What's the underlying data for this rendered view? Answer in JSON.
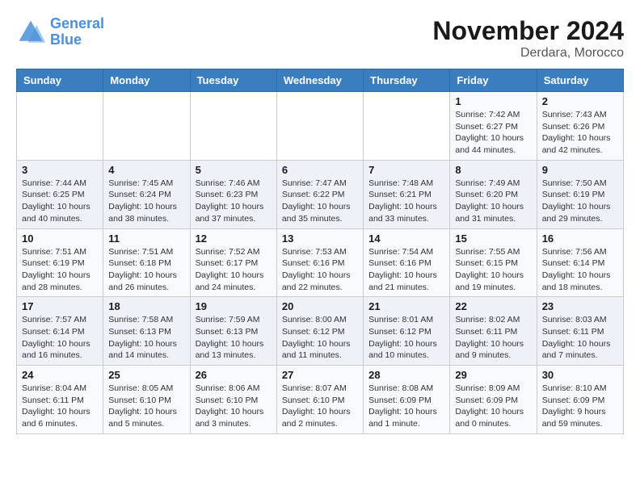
{
  "header": {
    "logo_line1": "General",
    "logo_line2": "Blue",
    "month": "November 2024",
    "location": "Derdara, Morocco"
  },
  "weekdays": [
    "Sunday",
    "Monday",
    "Tuesday",
    "Wednesday",
    "Thursday",
    "Friday",
    "Saturday"
  ],
  "weeks": [
    [
      {
        "day": "",
        "info": ""
      },
      {
        "day": "",
        "info": ""
      },
      {
        "day": "",
        "info": ""
      },
      {
        "day": "",
        "info": ""
      },
      {
        "day": "",
        "info": ""
      },
      {
        "day": "1",
        "info": "Sunrise: 7:42 AM\nSunset: 6:27 PM\nDaylight: 10 hours and 44 minutes."
      },
      {
        "day": "2",
        "info": "Sunrise: 7:43 AM\nSunset: 6:26 PM\nDaylight: 10 hours and 42 minutes."
      }
    ],
    [
      {
        "day": "3",
        "info": "Sunrise: 7:44 AM\nSunset: 6:25 PM\nDaylight: 10 hours and 40 minutes."
      },
      {
        "day": "4",
        "info": "Sunrise: 7:45 AM\nSunset: 6:24 PM\nDaylight: 10 hours and 38 minutes."
      },
      {
        "day": "5",
        "info": "Sunrise: 7:46 AM\nSunset: 6:23 PM\nDaylight: 10 hours and 37 minutes."
      },
      {
        "day": "6",
        "info": "Sunrise: 7:47 AM\nSunset: 6:22 PM\nDaylight: 10 hours and 35 minutes."
      },
      {
        "day": "7",
        "info": "Sunrise: 7:48 AM\nSunset: 6:21 PM\nDaylight: 10 hours and 33 minutes."
      },
      {
        "day": "8",
        "info": "Sunrise: 7:49 AM\nSunset: 6:20 PM\nDaylight: 10 hours and 31 minutes."
      },
      {
        "day": "9",
        "info": "Sunrise: 7:50 AM\nSunset: 6:19 PM\nDaylight: 10 hours and 29 minutes."
      }
    ],
    [
      {
        "day": "10",
        "info": "Sunrise: 7:51 AM\nSunset: 6:19 PM\nDaylight: 10 hours and 28 minutes."
      },
      {
        "day": "11",
        "info": "Sunrise: 7:51 AM\nSunset: 6:18 PM\nDaylight: 10 hours and 26 minutes."
      },
      {
        "day": "12",
        "info": "Sunrise: 7:52 AM\nSunset: 6:17 PM\nDaylight: 10 hours and 24 minutes."
      },
      {
        "day": "13",
        "info": "Sunrise: 7:53 AM\nSunset: 6:16 PM\nDaylight: 10 hours and 22 minutes."
      },
      {
        "day": "14",
        "info": "Sunrise: 7:54 AM\nSunset: 6:16 PM\nDaylight: 10 hours and 21 minutes."
      },
      {
        "day": "15",
        "info": "Sunrise: 7:55 AM\nSunset: 6:15 PM\nDaylight: 10 hours and 19 minutes."
      },
      {
        "day": "16",
        "info": "Sunrise: 7:56 AM\nSunset: 6:14 PM\nDaylight: 10 hours and 18 minutes."
      }
    ],
    [
      {
        "day": "17",
        "info": "Sunrise: 7:57 AM\nSunset: 6:14 PM\nDaylight: 10 hours and 16 minutes."
      },
      {
        "day": "18",
        "info": "Sunrise: 7:58 AM\nSunset: 6:13 PM\nDaylight: 10 hours and 14 minutes."
      },
      {
        "day": "19",
        "info": "Sunrise: 7:59 AM\nSunset: 6:13 PM\nDaylight: 10 hours and 13 minutes."
      },
      {
        "day": "20",
        "info": "Sunrise: 8:00 AM\nSunset: 6:12 PM\nDaylight: 10 hours and 11 minutes."
      },
      {
        "day": "21",
        "info": "Sunrise: 8:01 AM\nSunset: 6:12 PM\nDaylight: 10 hours and 10 minutes."
      },
      {
        "day": "22",
        "info": "Sunrise: 8:02 AM\nSunset: 6:11 PM\nDaylight: 10 hours and 9 minutes."
      },
      {
        "day": "23",
        "info": "Sunrise: 8:03 AM\nSunset: 6:11 PM\nDaylight: 10 hours and 7 minutes."
      }
    ],
    [
      {
        "day": "24",
        "info": "Sunrise: 8:04 AM\nSunset: 6:11 PM\nDaylight: 10 hours and 6 minutes."
      },
      {
        "day": "25",
        "info": "Sunrise: 8:05 AM\nSunset: 6:10 PM\nDaylight: 10 hours and 5 minutes."
      },
      {
        "day": "26",
        "info": "Sunrise: 8:06 AM\nSunset: 6:10 PM\nDaylight: 10 hours and 3 minutes."
      },
      {
        "day": "27",
        "info": "Sunrise: 8:07 AM\nSunset: 6:10 PM\nDaylight: 10 hours and 2 minutes."
      },
      {
        "day": "28",
        "info": "Sunrise: 8:08 AM\nSunset: 6:09 PM\nDaylight: 10 hours and 1 minute."
      },
      {
        "day": "29",
        "info": "Sunrise: 8:09 AM\nSunset: 6:09 PM\nDaylight: 10 hours and 0 minutes."
      },
      {
        "day": "30",
        "info": "Sunrise: 8:10 AM\nSunset: 6:09 PM\nDaylight: 9 hours and 59 minutes."
      }
    ]
  ]
}
